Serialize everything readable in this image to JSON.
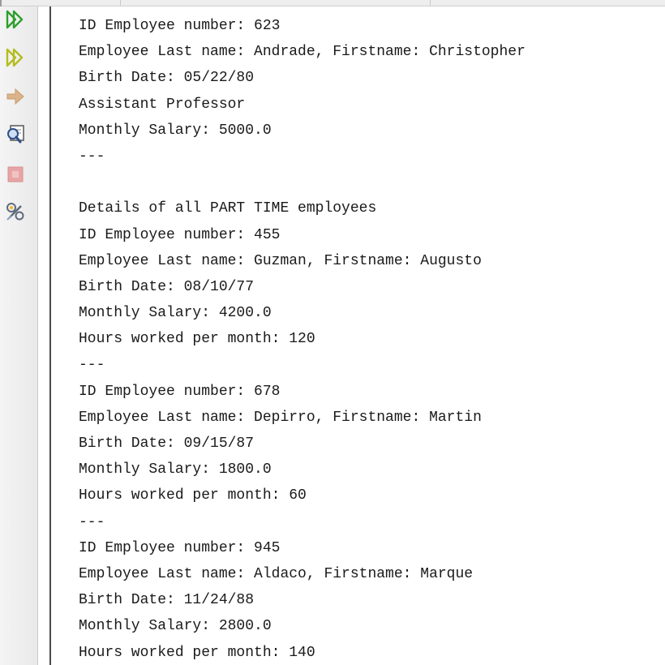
{
  "toolbar": {
    "buttons": [
      {
        "name": "rerun",
        "icon": "double-play-green-icon",
        "color": "#3cae3c"
      },
      {
        "name": "rerun-with-changes",
        "icon": "double-play-yellow-icon",
        "color": "#b9c42a"
      },
      {
        "name": "continue",
        "icon": "arrow-right-icon",
        "color": "#d8b08a"
      },
      {
        "name": "find",
        "icon": "search-window-icon",
        "color": "#4a6fa5"
      },
      {
        "name": "stop",
        "icon": "stop-icon",
        "color": "#e59a9a"
      },
      {
        "name": "settings",
        "icon": "tools-icon",
        "color": "#7a8a9a"
      }
    ]
  },
  "console": {
    "lines": [
      "ID Employee number: 623",
      "Employee Last name: Andrade, Firstname: Christopher",
      "Birth Date: 05/22/80",
      "Assistant Professor",
      "Monthly Salary: 5000.0",
      "---",
      "",
      "Details of all PART TIME employees",
      "ID Employee number: 455",
      "Employee Last name: Guzman, Firstname: Augusto",
      "Birth Date: 08/10/77",
      "Monthly Salary: 4200.0",
      "Hours worked per month: 120",
      "---",
      "ID Employee number: 678",
      "Employee Last name: Depirro, Firstname: Martin",
      "Birth Date: 09/15/87",
      "Monthly Salary: 1800.0",
      "Hours worked per month: 60",
      "---",
      "ID Employee number: 945",
      "Employee Last name: Aldaco, Firstname: Marque",
      "Birth Date: 11/24/88",
      "Monthly Salary: 2800.0",
      "Hours worked per month: 140"
    ]
  }
}
